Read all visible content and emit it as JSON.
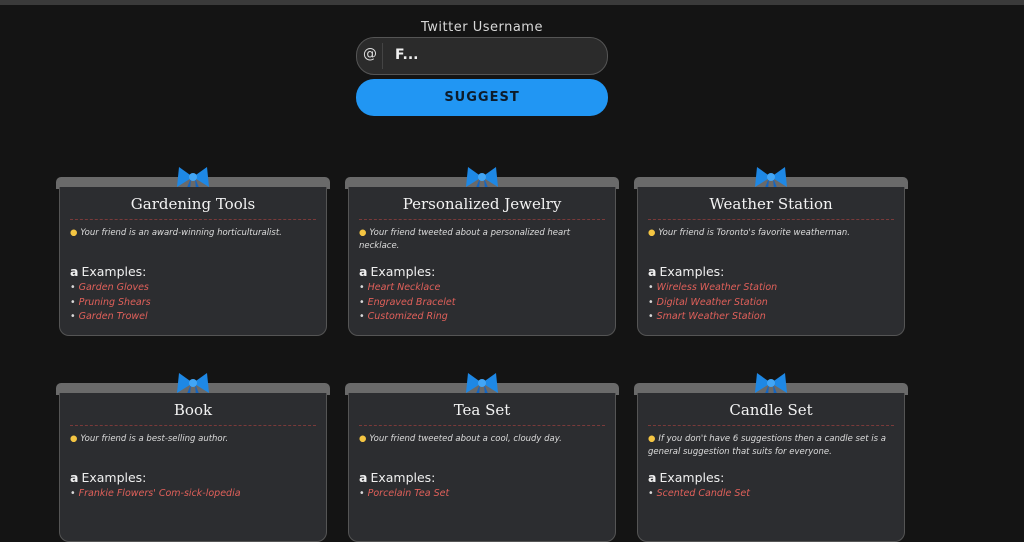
{
  "form": {
    "label": "Twitter Username",
    "at_symbol": "@",
    "username_value": "F...",
    "suggest_label": "SUGGEST"
  },
  "colors": {
    "accent": "#2196f3",
    "link": "#e0605a",
    "background": "#141414",
    "card": "#2c2d30"
  },
  "examples_heading": "Examples:",
  "cards": [
    {
      "title": "Gardening Tools",
      "reason": "Your friend is an award-winning horticulturalist.",
      "examples": [
        "Garden Gloves",
        "Pruning Shears",
        "Garden Trowel"
      ]
    },
    {
      "title": "Personalized Jewelry",
      "reason": "Your friend tweeted about a personalized heart necklace.",
      "examples": [
        "Heart Necklace",
        "Engraved Bracelet",
        "Customized Ring"
      ]
    },
    {
      "title": "Weather Station",
      "reason": "Your friend is Toronto's favorite weatherman.",
      "examples": [
        "Wireless Weather Station",
        "Digital Weather Station",
        "Smart Weather Station"
      ]
    },
    {
      "title": "Book",
      "reason": "Your friend is a best-selling author.",
      "examples": [
        "Frankie Flowers' Com-sick-lopedia"
      ]
    },
    {
      "title": "Tea Set",
      "reason": "Your friend tweeted about a cool, cloudy day.",
      "examples": [
        "Porcelain Tea Set"
      ]
    },
    {
      "title": "Candle Set",
      "reason": "If you don't have 6 suggestions then a candle set is a general suggestion that suits for everyone.",
      "examples": [
        "Scented Candle Set"
      ]
    }
  ]
}
